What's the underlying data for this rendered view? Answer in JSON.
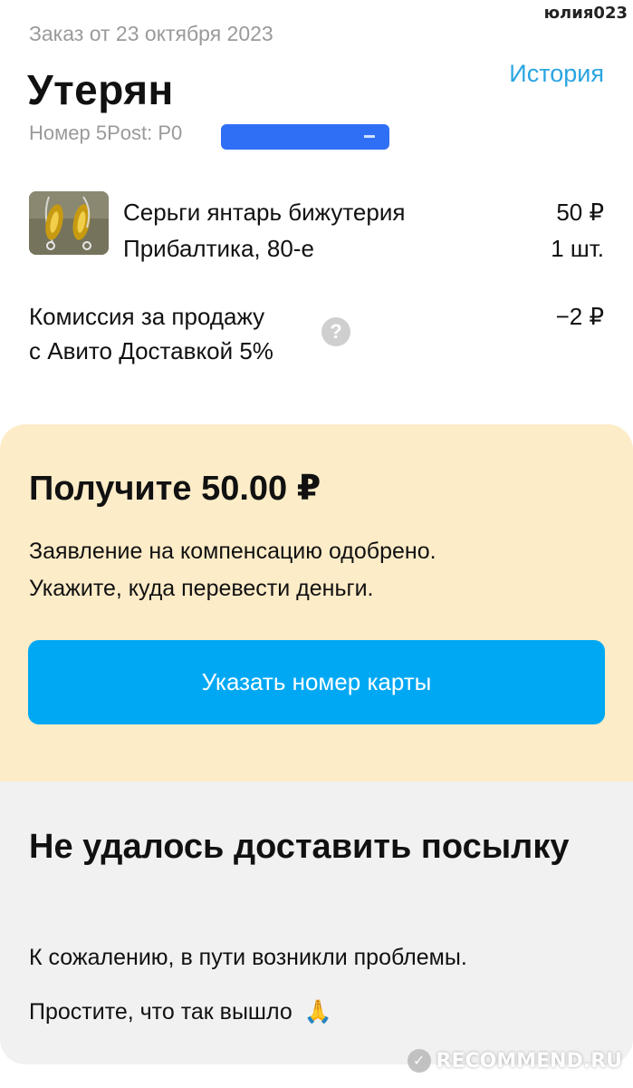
{
  "watermark_user": "юлия023",
  "order": {
    "date": "Заказ от 23 октября 2023",
    "status": "Утерян",
    "history_link": "История",
    "tracking": "Номер 5Post: P0"
  },
  "item": {
    "name_line1": "Серьги янтарь бижутерия",
    "name_line2": "Прибалтика, 80-е",
    "price": "50 ₽",
    "quantity": "1 шт."
  },
  "commission": {
    "label_line1": "Комиссия за продажу",
    "label_line2": "с Авито Доставкой 5%",
    "help_icon": "?",
    "value": "−2 ₽"
  },
  "compensation": {
    "title": "Получите 50.00 ₽",
    "text_line1": "Заявление на компенсацию одобрено.",
    "text_line2": "Укажите, куда перевести деньги.",
    "button_label": "Указать номер карты"
  },
  "delivery_failure": {
    "title": "Не удалось доставить посылку",
    "text_line1": "К сожалению, в пути возникли проблемы.",
    "text_line2": "Простите, что так вышло",
    "emoji": "🙏"
  },
  "watermark_site": "RECOMMEND.RU",
  "colors": {
    "accent_link": "#2aa5e0",
    "button": "#00a8f3",
    "compensation_bg": "#fdecc8",
    "failure_bg": "#f1f1f1",
    "muted_text": "#9a9a9a"
  },
  "icons": [
    "help-icon",
    "praying-hands-emoji",
    "recommend-logo-icon"
  ]
}
